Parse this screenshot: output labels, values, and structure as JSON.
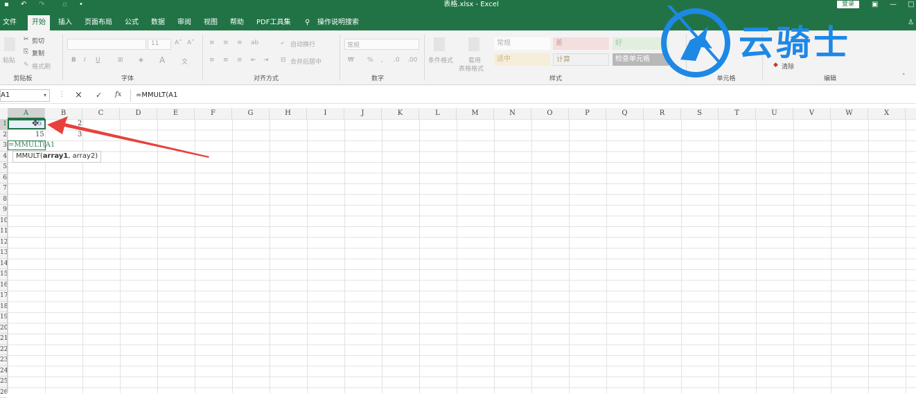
{
  "window": {
    "title": "表格.xlsx  -  Excel",
    "login_label": "登录"
  },
  "tabs": [
    "文件",
    "开始",
    "插入",
    "页面布局",
    "公式",
    "数据",
    "审阅",
    "视图",
    "帮助",
    "PDF工具集",
    "操作说明搜索"
  ],
  "active_tab": "开始",
  "ribbon": {
    "clipboard": {
      "paste": "粘贴",
      "cut": "剪切",
      "copy": "复制",
      "format_painter": "格式刷",
      "group": "剪贴板"
    },
    "font": {
      "size": "11",
      "group": "字体"
    },
    "alignment": {
      "wrap": "自动换行",
      "merge": "合并后居中",
      "group": "对齐方式"
    },
    "number": {
      "format": "常规",
      "group": "数字"
    },
    "styles": {
      "conditional": "条件格式",
      "table_format_1": "套用",
      "table_format_2": "表格格式",
      "cells": [
        "常规",
        "差",
        "好",
        "适中",
        "计算",
        "检查单元格"
      ],
      "group": "样式"
    },
    "cells": {
      "group": "单元格"
    },
    "editing": {
      "clear": "清除",
      "group": "编辑"
    },
    "watermark": "云骑士"
  },
  "formula_bar": {
    "name_box": "A1",
    "cancel": "×",
    "enter": "✓",
    "fx": "fx",
    "formula": "=MMULT(A1"
  },
  "columns": [
    "A",
    "B",
    "C",
    "D",
    "E",
    "F",
    "G",
    "H",
    "I",
    "J",
    "K",
    "L",
    "M",
    "N",
    "O",
    "P",
    "Q",
    "R",
    "S",
    "T",
    "U",
    "V",
    "W",
    "X"
  ],
  "rows": [
    "1",
    "2",
    "3",
    "4",
    "5",
    "6",
    "7",
    "8",
    "9",
    "10",
    "11",
    "12",
    "13",
    "14",
    "15",
    "16",
    "17",
    "18",
    "19",
    "20",
    "21",
    "22",
    "23",
    "24",
    "25",
    "26"
  ],
  "cells": {
    "A1": "5",
    "B1": "2",
    "A2": "15",
    "B2": "3",
    "A3": "=MMULT(A1"
  },
  "tooltip": {
    "fn": "MMULT(",
    "arg1": "array1",
    "rest": ", array2)"
  },
  "colors": {
    "accent": "#217346",
    "arrow": "#e8413c",
    "logo": "#1e88e5"
  }
}
